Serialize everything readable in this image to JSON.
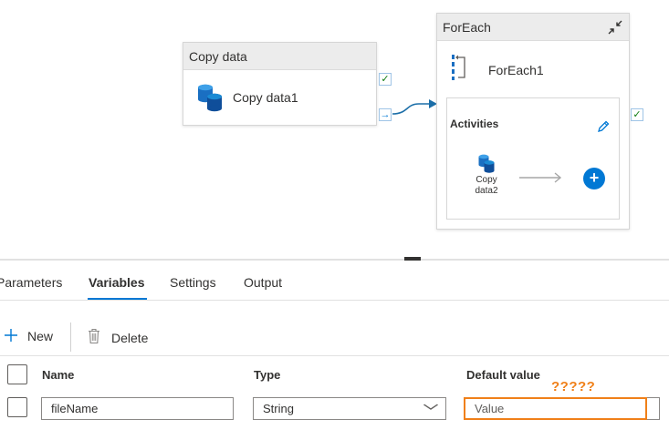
{
  "canvas": {
    "copy_activity": {
      "header": "Copy data",
      "label": "Copy data1",
      "icon": "database-copy-icon"
    },
    "foreach_activity": {
      "header": "ForEach",
      "label": "ForEach1",
      "icon": "foreach-icon",
      "collapse_icon": "collapse-arrows-icon",
      "activities_label": "Activities",
      "inner_activity_label_line1": "Copy",
      "inner_activity_label_line2": "data2",
      "add_symbol": "+"
    },
    "status_glyphs": {
      "success": "✓",
      "next": "→"
    }
  },
  "tabs": [
    {
      "label": "Parameters",
      "active": false
    },
    {
      "label": "Variables",
      "active": true
    },
    {
      "label": "Settings",
      "active": false
    },
    {
      "label": "Output",
      "active": false
    }
  ],
  "toolbar": {
    "new_label": "New",
    "delete_label": "Delete"
  },
  "grid": {
    "columns": [
      "Name",
      "Type",
      "Default value"
    ],
    "rows": [
      {
        "name": "fileName",
        "type": "String",
        "default_placeholder": "Value"
      }
    ]
  },
  "annotation": "?????",
  "colors": {
    "accent": "#0078d4",
    "success": "#107c10",
    "highlight": "#f08019"
  }
}
